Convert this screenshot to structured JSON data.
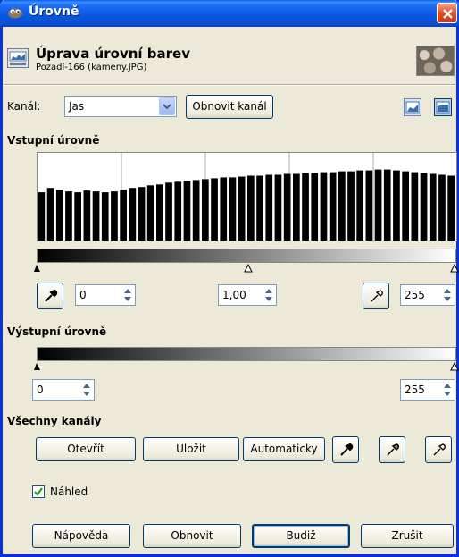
{
  "window": {
    "title": "Úrovně"
  },
  "header": {
    "title": "Úprava úrovní barev",
    "subtitle": "Pozadí-166 (kameny.JPG)"
  },
  "channel": {
    "label": "Kanál:",
    "value": "Jas",
    "reset_label": "Obnovit kanál"
  },
  "input_levels": {
    "heading": "Vstupní úrovně",
    "low": "0",
    "gamma": "1,00",
    "high": "255"
  },
  "output_levels": {
    "heading": "Výstupní úrovně",
    "low": "0",
    "high": "255"
  },
  "all_channels": {
    "heading": "Všechny kanály",
    "open_label": "Otevřít",
    "save_label": "Uložit",
    "auto_label": "Automaticky"
  },
  "preview": {
    "label": "Náhled",
    "checked": true
  },
  "buttons": {
    "help": "Nápověda",
    "reset": "Obnovit",
    "ok": "Budiž",
    "cancel": "Zrušit"
  },
  "histogram": {
    "values": [
      0.55,
      0.6,
      0.58,
      0.56,
      0.55,
      0.57,
      0.56,
      0.55,
      0.56,
      0.58,
      0.6,
      0.61,
      0.63,
      0.64,
      0.66,
      0.67,
      0.68,
      0.69,
      0.7,
      0.71,
      0.72,
      0.72,
      0.73,
      0.74,
      0.74,
      0.75,
      0.75,
      0.76,
      0.76,
      0.77,
      0.77,
      0.78,
      0.78,
      0.79,
      0.79,
      0.8,
      0.8,
      0.81,
      0.81,
      0.8,
      0.79,
      0.78,
      0.77,
      0.76,
      0.75,
      0.74
    ]
  }
}
